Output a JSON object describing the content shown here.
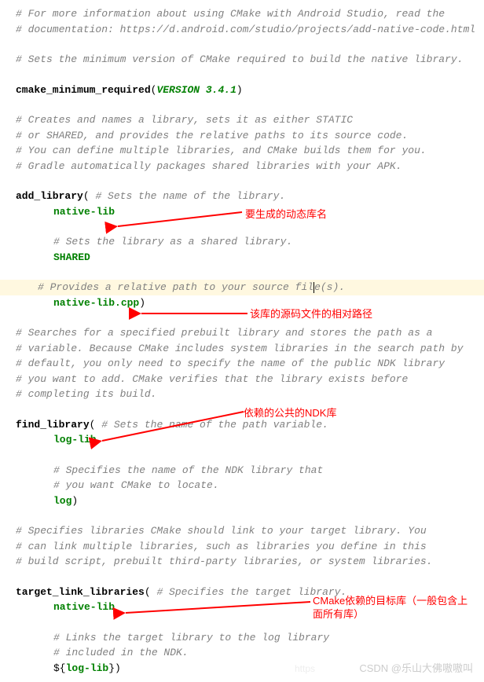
{
  "lines": {
    "c1": "# For more information about using CMake with Android Studio, read the",
    "c2": "# documentation: https://d.android.com/studio/projects/add-native-code.html",
    "c3": "# Sets the minimum version of CMake required to build the native library.",
    "cmr_fn": "cmake_minimum_required",
    "cmr_ver_kw": "VERSION 3.4.1",
    "c4": "# Creates and names a library, sets it as either STATIC",
    "c5": "# or SHARED, and provides the relative paths to its source code.",
    "c6": "# You can define multiple libraries, and CMake builds them for you.",
    "c7": "# Gradle automatically packages shared libraries with your APK.",
    "add_fn": "add_library",
    "add_c1": " # Sets the name of the library.",
    "native_lib": "native-lib",
    "add_c2": "# Sets the library as a shared library.",
    "shared": "SHARED",
    "add_c3": "# Provides a relative path to your source fil",
    "add_c3b": "e(s).",
    "native_cpp": "native-lib.cpp",
    "c8": "# Searches for a specified prebuilt library and stores the path as a",
    "c9": "# variable. Because CMake includes system libraries in the search path by",
    "c10": "# default, you only need to specify the name of the public NDK library",
    "c11": "# you want to add. CMake verifies that the library exists before",
    "c12": "# completing its build.",
    "find_fn": "find_library",
    "find_c1": " # Sets the name of the path variable.",
    "log_lib": "log-lib",
    "find_c2": "# Specifies the name of the NDK library that",
    "find_c3": "# you want CMake to locate.",
    "log": "log",
    "c13": "# Specifies libraries CMake should link to your target library. You",
    "c14": "# can link multiple libraries, such as libraries you define in this",
    "c15": "# build script, prebuilt third-party libraries, or system libraries.",
    "tll_fn": "target_link_libraries",
    "tll_c1": " # Specifies the target library.",
    "tll_c2": "# Links the target library to the log library",
    "tll_c3": "# included in the NDK.",
    "dollar_open": "${",
    "dollar_close": "}"
  },
  "annotations": {
    "a1": "要生成的动态库名",
    "a2": "该库的源码文件的相对路径",
    "a3": "依赖的公共的NDK库",
    "a4a": "CMake依赖的目标库（一般包含上",
    "a4b": "面所有库）"
  },
  "watermark": "CSDN @乐山大佛嗷嗷叫",
  "watermark2": "https"
}
